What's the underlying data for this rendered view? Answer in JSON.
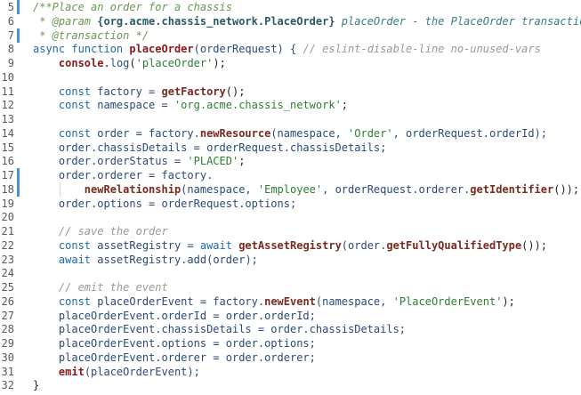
{
  "editor": {
    "lines": [
      {
        "n": "5",
        "mod": true,
        "tokens": [
          {
            "t": "/**Place an order for a chassis",
            "c": "cm"
          }
        ]
      },
      {
        "n": "6",
        "mod": false,
        "tokens": [
          {
            "t": " * @param ",
            "c": "cm"
          },
          {
            "t": "{org.acme.chassis_network.PlaceOrder}",
            "c": "cm-type"
          },
          {
            "t": " placeOrder - the PlaceOrder transaction",
            "c": "cm-var"
          }
        ]
      },
      {
        "n": "7",
        "mod": true,
        "tokens": [
          {
            "t": " * @transaction */",
            "c": "cm"
          }
        ]
      },
      {
        "n": "8",
        "mod": false,
        "tokens": [
          {
            "t": "async function ",
            "c": "kw"
          },
          {
            "t": "placeOrder",
            "c": "fnb"
          },
          {
            "t": "(orderRequest) { ",
            "c": "id"
          },
          {
            "t": "// eslint-disable-line no-unused-vars",
            "c": "cmt2"
          }
        ]
      },
      {
        "n": "9",
        "mod": false,
        "tokens": [
          {
            "t": "    console",
            "c": "fnb"
          },
          {
            "t": ".",
            "c": "pl"
          },
          {
            "t": "log",
            "c": "id"
          },
          {
            "t": "(",
            "c": "pl"
          },
          {
            "t": "'placeOrder'",
            "c": "str"
          },
          {
            "t": ");",
            "c": "pl"
          }
        ]
      },
      {
        "n": "10",
        "mod": false,
        "tokens": []
      },
      {
        "n": "11",
        "mod": false,
        "tokens": [
          {
            "t": "    const ",
            "c": "kw"
          },
          {
            "t": "factory = ",
            "c": "id"
          },
          {
            "t": "getFactory",
            "c": "fn"
          },
          {
            "t": "();",
            "c": "pl"
          }
        ]
      },
      {
        "n": "12",
        "mod": false,
        "tokens": [
          {
            "t": "    const ",
            "c": "kw"
          },
          {
            "t": "namespace = ",
            "c": "id"
          },
          {
            "t": "'org.acme.chassis_network'",
            "c": "str"
          },
          {
            "t": ";",
            "c": "pl"
          }
        ]
      },
      {
        "n": "13",
        "mod": false,
        "tokens": []
      },
      {
        "n": "14",
        "mod": false,
        "tokens": [
          {
            "t": "    const ",
            "c": "kw"
          },
          {
            "t": "order = factory.",
            "c": "id"
          },
          {
            "t": "newResource",
            "c": "fn"
          },
          {
            "t": "(namespace, ",
            "c": "id"
          },
          {
            "t": "'Order'",
            "c": "str"
          },
          {
            "t": ", orderRequest.orderId);",
            "c": "id"
          }
        ]
      },
      {
        "n": "15",
        "mod": false,
        "tokens": [
          {
            "t": "    order.chassisDetails = orderRequest.chassisDetails;",
            "c": "id"
          }
        ]
      },
      {
        "n": "16",
        "mod": false,
        "tokens": [
          {
            "t": "    order.orderStatus = ",
            "c": "id"
          },
          {
            "t": "'PLACED'",
            "c": "str"
          },
          {
            "t": ";",
            "c": "pl"
          }
        ]
      },
      {
        "n": "17",
        "mod": true,
        "tokens": [
          {
            "t": "    order.orderer = factory.",
            "c": "id"
          }
        ]
      },
      {
        "n": "18",
        "mod": true,
        "guide": true,
        "tokens": [
          {
            "t": "        ",
            "c": "pl"
          },
          {
            "t": "newRelationship",
            "c": "fn"
          },
          {
            "t": "(namespace, ",
            "c": "id"
          },
          {
            "t": "'Employee'",
            "c": "str"
          },
          {
            "t": ", orderRequest.orderer.",
            "c": "id"
          },
          {
            "t": "getIdentifier",
            "c": "fn"
          },
          {
            "t": "());",
            "c": "pl"
          }
        ]
      },
      {
        "n": "19",
        "mod": false,
        "tokens": [
          {
            "t": "    order.options = orderRequest.options;",
            "c": "id"
          }
        ]
      },
      {
        "n": "20",
        "mod": false,
        "tokens": []
      },
      {
        "n": "21",
        "mod": false,
        "tokens": [
          {
            "t": "    // save the order",
            "c": "cmt2"
          }
        ]
      },
      {
        "n": "22",
        "mod": false,
        "tokens": [
          {
            "t": "    const ",
            "c": "kw"
          },
          {
            "t": "assetRegistry = ",
            "c": "id"
          },
          {
            "t": "await ",
            "c": "kw"
          },
          {
            "t": "getAssetRegistry",
            "c": "fn"
          },
          {
            "t": "(order.",
            "c": "id"
          },
          {
            "t": "getFullyQualifiedType",
            "c": "fn"
          },
          {
            "t": "());",
            "c": "pl"
          }
        ]
      },
      {
        "n": "23",
        "mod": false,
        "tokens": [
          {
            "t": "    await ",
            "c": "kw"
          },
          {
            "t": "assetRegistry.",
            "c": "id"
          },
          {
            "t": "add",
            "c": "id"
          },
          {
            "t": "(order);",
            "c": "id"
          }
        ]
      },
      {
        "n": "24",
        "mod": false,
        "tokens": []
      },
      {
        "n": "25",
        "mod": false,
        "tokens": [
          {
            "t": "    // emit the event",
            "c": "cmt2"
          }
        ]
      },
      {
        "n": "26",
        "mod": false,
        "tokens": [
          {
            "t": "    const ",
            "c": "kw"
          },
          {
            "t": "placeOrderEvent = factory.",
            "c": "id"
          },
          {
            "t": "newEvent",
            "c": "fn"
          },
          {
            "t": "(namespace, ",
            "c": "id"
          },
          {
            "t": "'PlaceOrderEvent'",
            "c": "str"
          },
          {
            "t": ");",
            "c": "pl"
          }
        ]
      },
      {
        "n": "27",
        "mod": false,
        "tokens": [
          {
            "t": "    placeOrderEvent.orderId = order.orderId;",
            "c": "id"
          }
        ]
      },
      {
        "n": "28",
        "mod": false,
        "tokens": [
          {
            "t": "    placeOrderEvent.chassisDetails = order.chassisDetails;",
            "c": "id"
          }
        ]
      },
      {
        "n": "29",
        "mod": false,
        "tokens": [
          {
            "t": "    placeOrderEvent.options = order.options;",
            "c": "id"
          }
        ]
      },
      {
        "n": "30",
        "mod": false,
        "tokens": [
          {
            "t": "    placeOrderEvent.orderer = order.orderer;",
            "c": "id"
          }
        ]
      },
      {
        "n": "31",
        "mod": false,
        "tokens": [
          {
            "t": "    ",
            "c": "pl"
          },
          {
            "t": "emit",
            "c": "fnb"
          },
          {
            "t": "(placeOrderEvent);",
            "c": "id"
          }
        ]
      },
      {
        "n": "32",
        "mod": false,
        "tokens": [
          {
            "t": "}",
            "c": "pl"
          }
        ]
      }
    ]
  }
}
